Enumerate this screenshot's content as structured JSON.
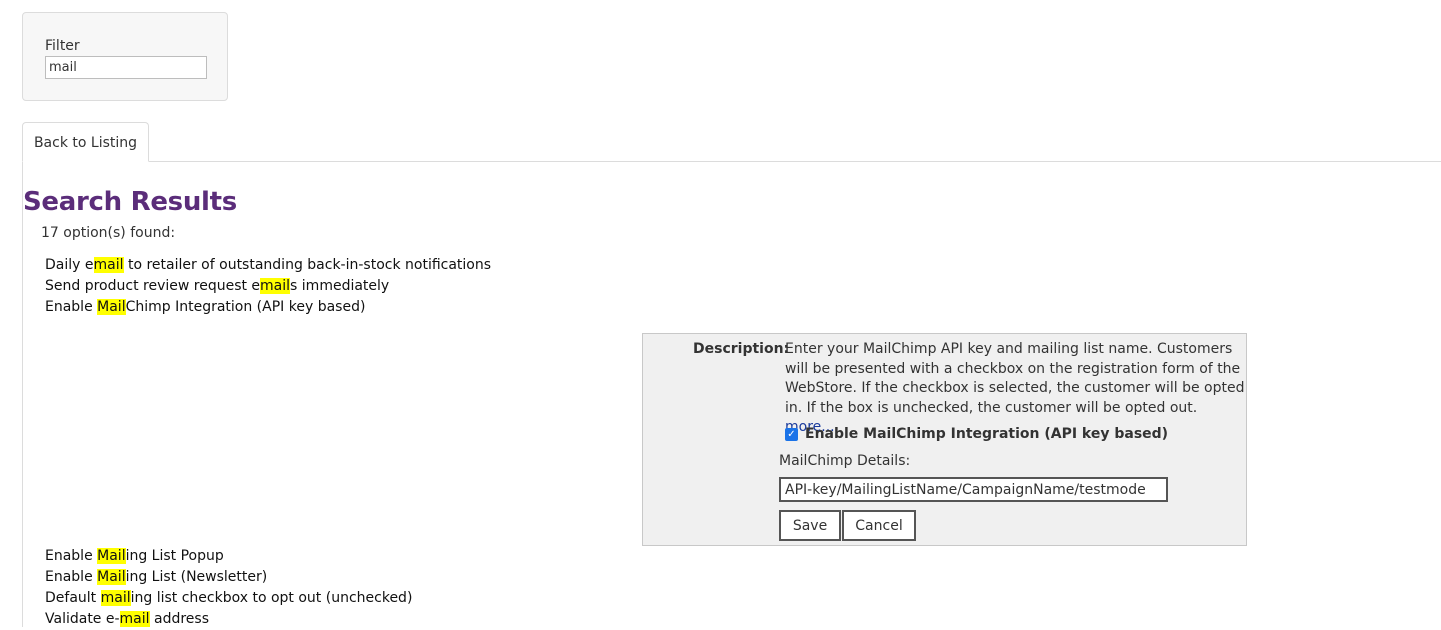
{
  "filter": {
    "label": "Filter",
    "value": "mail"
  },
  "tabs": {
    "back_label": "Back to Listing"
  },
  "search": {
    "title": "Search Results",
    "count_text": "17 option(s) found:",
    "results_top": [
      {
        "pre": "Daily e",
        "hl": "mail",
        "post": " to retailer of outstanding back-in-stock notifications"
      },
      {
        "pre": "Send product review request e",
        "hl": "mail",
        "post": "s immediately"
      },
      {
        "pre": "Enable ",
        "hl": "Mail",
        "post": "Chimp Integration (API key based)"
      }
    ],
    "results_bottom": [
      {
        "pre": "Enable ",
        "hl": "Mail",
        "post": "ing List Popup"
      },
      {
        "pre": "Enable ",
        "hl": "Mail",
        "post": "ing List (Newsletter)"
      },
      {
        "pre": "Default ",
        "hl": "mail",
        "post": "ing list checkbox to opt out (unchecked)"
      },
      {
        "pre": "Validate e-",
        "hl": "mail",
        "post": " address"
      }
    ]
  },
  "detail": {
    "description_label": "Description:",
    "description_text": "Enter your MailChimp API key and mailing list name. Customers will be presented with a checkbox on the registration form of the WebStore. If the checkbox is selected, the customer will be opted in. If the box is unchecked, the customer will be opted out.",
    "more_link": "more...",
    "enable_checked": true,
    "enable_label": "Enable MailChimp Integration (API key based)",
    "details_label": "MailChimp Details:",
    "details_value": "API-key/MailingListName/CampaignName/testmode",
    "save_label": "Save",
    "cancel_label": "Cancel"
  },
  "colors": {
    "title": "#5b2d7a",
    "highlight": "#ffff00",
    "link": "#1a3a9c",
    "checkbox": "#1a73e8"
  }
}
